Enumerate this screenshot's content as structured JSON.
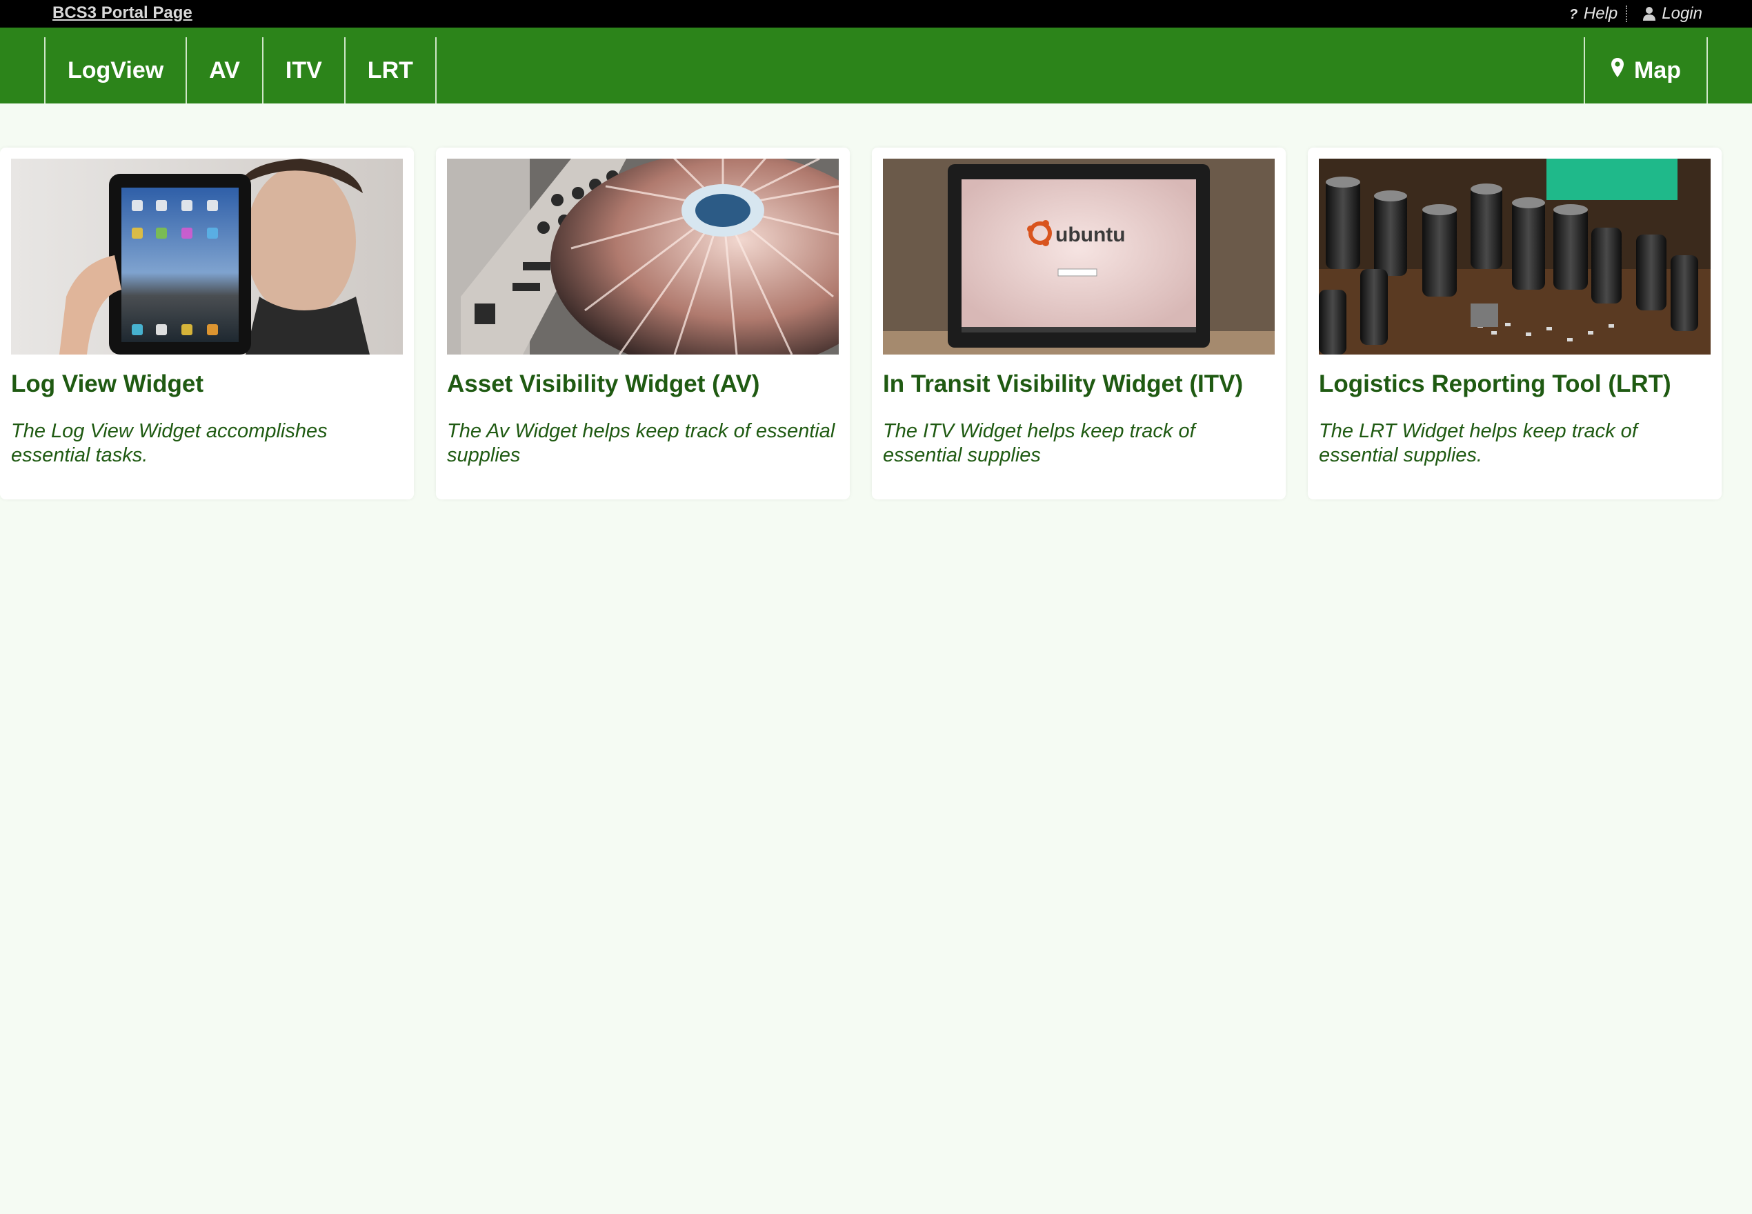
{
  "topbar": {
    "portal_link": "BCS3 Portal Page",
    "help_label": "Help",
    "help_icon": "question-icon",
    "login_label": "Login",
    "login_icon": "user-icon"
  },
  "nav": {
    "items": [
      {
        "label": "LogView"
      },
      {
        "label": "AV"
      },
      {
        "label": "ITV"
      },
      {
        "label": "LRT"
      }
    ],
    "map": {
      "label": "Map",
      "icon": "map-marker-icon"
    }
  },
  "cards": [
    {
      "title": "Log View Widget",
      "description": "The Log View Widget accomplishes essential tasks.",
      "image": "person-holding-tablet-image"
    },
    {
      "title": "Asset Visibility Widget (AV)",
      "description": "The Av Widget helps keep track of essential supplies",
      "image": "turntable-dj-mixer-image"
    },
    {
      "title": "In Transit Visibility Widget (ITV)",
      "description": "The ITV Widget helps keep track of essential supplies",
      "image": "laptop-ubuntu-login-image",
      "screen_text": "ubuntu"
    },
    {
      "title": "Logistics Reporting Tool (LRT)",
      "description": "The LRT Widget helps keep track of essential supplies.",
      "image": "circuit-board-capacitors-image"
    }
  ],
  "colors": {
    "topbar_bg": "#000000",
    "nav_bg": "#2c841a",
    "page_bg": "#f5fbf3",
    "card_text": "#1f5a12"
  }
}
